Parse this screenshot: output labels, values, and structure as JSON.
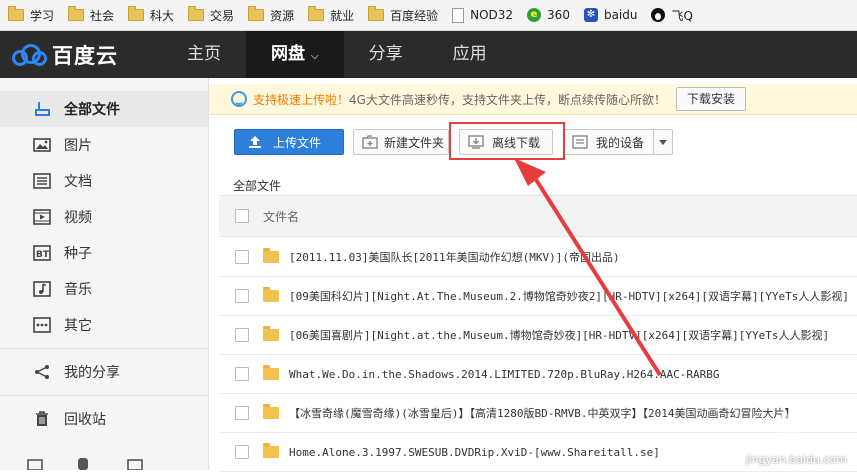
{
  "bookmarks": [
    {
      "label": "学习",
      "icon": "folder-icon"
    },
    {
      "label": "社会",
      "icon": "folder-icon"
    },
    {
      "label": "科大",
      "icon": "folder-icon"
    },
    {
      "label": "交易",
      "icon": "folder-icon"
    },
    {
      "label": "资源",
      "icon": "folder-icon"
    },
    {
      "label": "就业",
      "icon": "folder-icon"
    },
    {
      "label": "百度经验",
      "icon": "folder-icon"
    },
    {
      "label": "NOD32",
      "icon": "page-icon"
    },
    {
      "label": "360",
      "icon": "360-icon"
    },
    {
      "label": "baidu",
      "icon": "baidu-paw-icon"
    },
    {
      "label": "飞Q",
      "icon": "penguin-icon"
    }
  ],
  "header": {
    "logo_text": "百度云",
    "nav": [
      {
        "label": "主页",
        "active": false
      },
      {
        "label": "网盘",
        "active": true
      },
      {
        "label": "分享",
        "active": false
      },
      {
        "label": "应用",
        "active": false
      }
    ]
  },
  "sidebar": {
    "items": [
      {
        "label": "全部文件",
        "icon": "all-files-icon",
        "active": true
      },
      {
        "label": "图片",
        "icon": "image-icon"
      },
      {
        "label": "文档",
        "icon": "document-icon"
      },
      {
        "label": "视频",
        "icon": "video-icon"
      },
      {
        "label": "种子",
        "icon": "torrent-icon"
      },
      {
        "label": "音乐",
        "icon": "music-icon"
      },
      {
        "label": "其它",
        "icon": "more-icon"
      }
    ],
    "share_label": "我的分享",
    "trash_label": "回收站"
  },
  "notice": {
    "text_prefix": "支持极速上传啦！",
    "text_rest": "4G大文件高速秒传，支持文件夹上传，断点续传随心所欲！",
    "button": "下载安装"
  },
  "toolbar": {
    "upload": "上传文件",
    "new_folder": "新建文件夹",
    "offline_download": "离线下载",
    "my_devices": "我的设备"
  },
  "breadcrumb": "全部文件",
  "list": {
    "column_name": "文件名",
    "rows": [
      "[2011.11.03]美国队长[2011年美国动作幻想(MKV)](帝国出品)",
      "[09美国科幻片][Night.At.The.Museum.2.博物馆奇妙夜2][HR-HDTV][x264][双语字幕][YYeTs人人影视]",
      "[06美国喜剧片][Night.at.the.Museum.博物馆奇妙夜][HR-HDTV][x264][双语字幕][YYeTs人人影视]",
      "What.We.Do.in.the.Shadows.2014.LIMITED.720p.BluRay.H264.AAC-RARBG",
      "【冰雪奇缘(魔雪奇缘)(冰雪皇后)】【高清1280版BD-RMVB.中英双字】【2014美国动画奇幻冒险大片】",
      "Home.Alone.3.1997.SWESUB.DVDRip.XviD-[www.Shareitall.se]"
    ]
  },
  "watermark": "jingyan.baidu.com",
  "colors": {
    "accent": "#2d7fd9",
    "highlight": "#e63d3d",
    "header_bg": "#2b2b2b"
  }
}
